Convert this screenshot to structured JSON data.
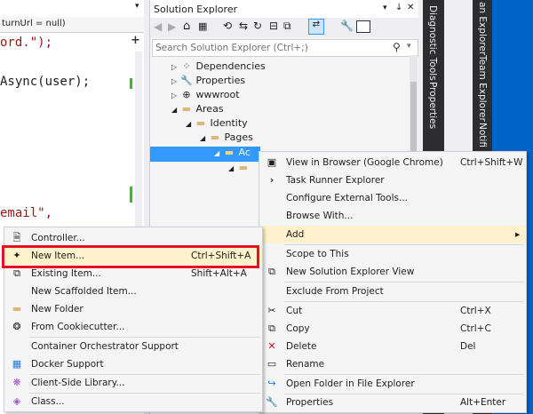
{
  "editor": {
    "top_dropdown": "turnUrl = null)",
    "code_lines": [
      "ord.\");",
      "Async(user);",
      "email\","
    ],
    "add_btn": "+"
  },
  "solution_explorer": {
    "title": "Solution Explorer",
    "pin_icon": "↓",
    "close_icon": "✕",
    "search_placeholder": "Search Solution Explorer (Ctrl+;)",
    "tree": [
      {
        "label": "Dependencies",
        "icon": "dependencies-icon"
      },
      {
        "label": "Properties",
        "icon": "wrench-icon"
      },
      {
        "label": "wwwroot",
        "icon": "globe-icon"
      },
      {
        "label": "Areas",
        "icon": "folder-icon"
      },
      {
        "label": "Identity",
        "icon": "folder-icon"
      },
      {
        "label": "Pages",
        "icon": "folder-icon"
      },
      {
        "label": "Ac",
        "icon": "folder-icon"
      }
    ]
  },
  "side_tabs": [
    "Diagnostic Tools",
    "Properties"
  ],
  "right_tabs": [
    "an Explorer",
    "Team Explorer",
    "Notifi"
  ],
  "context_menu": {
    "items": [
      {
        "label": "View in Browser (Google Chrome)",
        "shortcut": "Ctrl+Shift+W",
        "icon": "browser-icon"
      },
      {
        "label": "Task Runner Explorer",
        "shortcut": "",
        "icon": "chevron-right-icon"
      },
      {
        "label": "Configure External Tools...",
        "shortcut": "",
        "icon": ""
      },
      {
        "label": "Browse With...",
        "shortcut": "",
        "icon": ""
      },
      {
        "label": "Add",
        "shortcut": "",
        "icon": "",
        "submenu": true
      },
      {
        "label": "Scope to This",
        "shortcut": "",
        "icon": ""
      },
      {
        "label": "New Solution Explorer View",
        "shortcut": "",
        "icon": "new-view-icon"
      },
      {
        "label": "Exclude From Project",
        "shortcut": "",
        "icon": ""
      },
      {
        "label": "Cut",
        "shortcut": "Ctrl+X",
        "icon": "cut-icon"
      },
      {
        "label": "Copy",
        "shortcut": "Ctrl+C",
        "icon": "copy-icon"
      },
      {
        "label": "Delete",
        "shortcut": "Del",
        "icon": "delete-icon"
      },
      {
        "label": "Rename",
        "shortcut": "",
        "icon": "rename-icon"
      },
      {
        "label": "Open Folder in File Explorer",
        "shortcut": "",
        "icon": "open-folder-icon"
      },
      {
        "label": "Properties",
        "shortcut": "Alt+Enter",
        "icon": "wrench-icon"
      }
    ],
    "submenu_arrow": "▸"
  },
  "add_submenu": {
    "items": [
      {
        "label": "Controller...",
        "shortcut": "",
        "icon": "controller-icon"
      },
      {
        "label": "New Item...",
        "shortcut": "Ctrl+Shift+A",
        "icon": "new-item-icon"
      },
      {
        "label": "Existing Item...",
        "shortcut": "Shift+Alt+A",
        "icon": "existing-item-icon"
      },
      {
        "label": "New Scaffolded Item...",
        "shortcut": "",
        "icon": ""
      },
      {
        "label": "New Folder",
        "shortcut": "",
        "icon": "new-folder-icon"
      },
      {
        "label": "From Cookiecutter...",
        "shortcut": "",
        "icon": "cookiecutter-icon"
      },
      {
        "label": "Container Orchestrator Support",
        "shortcut": "",
        "icon": ""
      },
      {
        "label": "Docker Support",
        "shortcut": "",
        "icon": "docker-icon"
      },
      {
        "label": "Client-Side Library...",
        "shortcut": "",
        "icon": "library-icon"
      },
      {
        "label": "Class...",
        "shortcut": "",
        "icon": "class-icon"
      }
    ],
    "highlight_color": "#e81123"
  },
  "colors": {
    "accent": "#007acc",
    "selection": "#3399ff",
    "menu_hover": "#fff2cc",
    "highlight_box": "#e81123"
  }
}
